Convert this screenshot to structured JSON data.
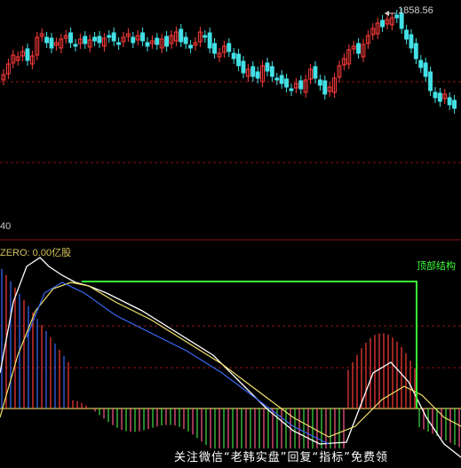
{
  "price_label": "1858.56",
  "axis_label": "40",
  "zero_label": "ZERO: 0.00亿股",
  "annotation": "顶部结构",
  "watermark": "关注微信“老韩实盘”回复“指标”免费领",
  "colors": {
    "background": "#000000",
    "up_candle": "#ff3b3b",
    "down_candle": "#43e0e6",
    "grid": "#8a1010",
    "zero_line": "#d4c25a",
    "annotation_box": "#39ff39",
    "line_white": "#ffffff",
    "line_yellow": "#f2e36b",
    "line_blue": "#3a6cff"
  }
}
